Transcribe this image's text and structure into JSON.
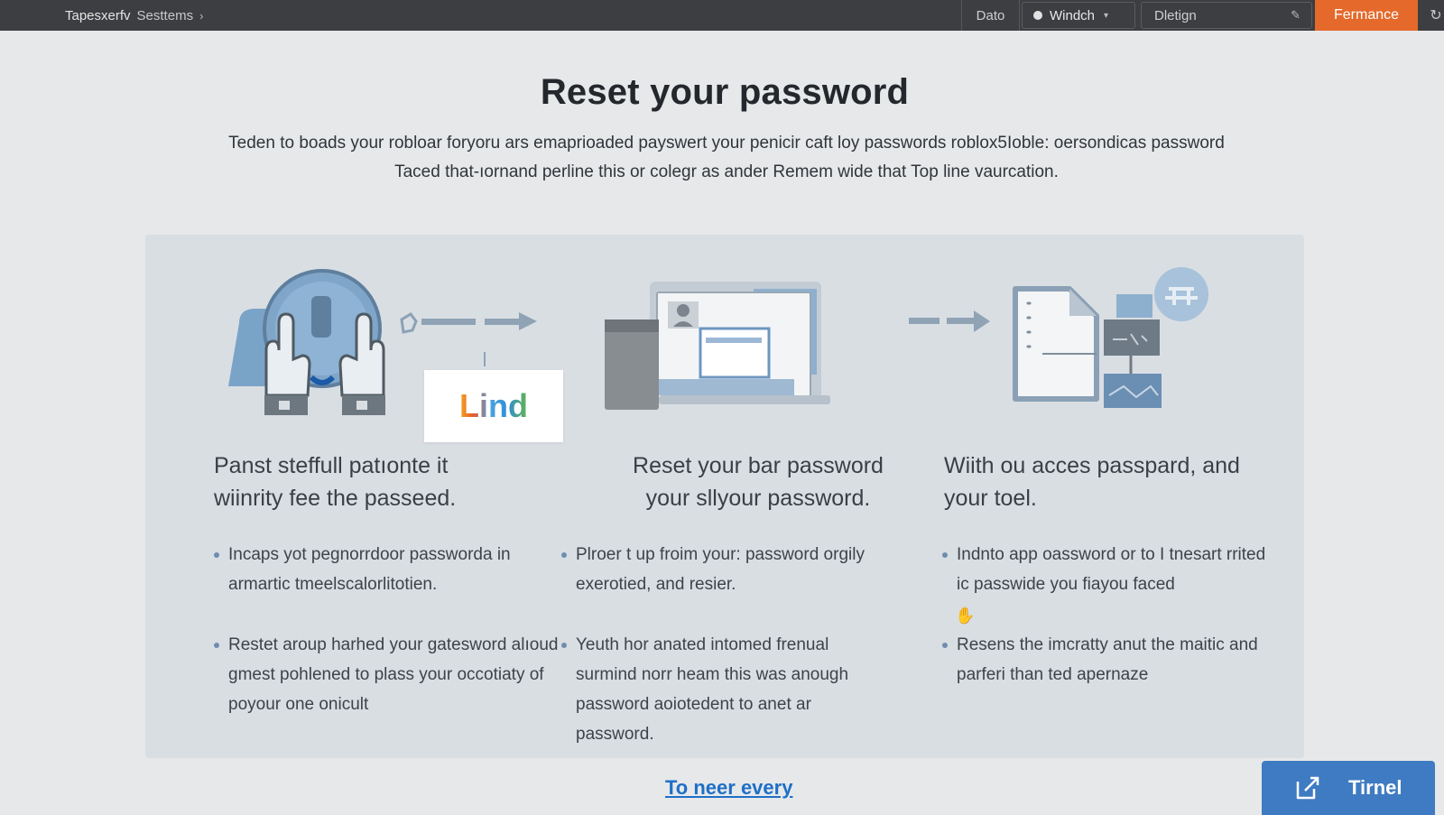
{
  "topbar": {
    "breadcrumb_root": "Tapesxerfv",
    "breadcrumb_current": "Sesttems",
    "breadcrumb_sep_icon": "chevron-right-icon",
    "date_label": "Dato",
    "window_label": "Windch",
    "design_label": "Dletign",
    "cta_label": "Fermance",
    "refresh_icon": "refresh-icon"
  },
  "colors": {
    "accent": "#e4692b",
    "link": "#1e6fc7",
    "button": "#3f7bc2",
    "topbar": "#3c3e41",
    "panel": "#d9dee3"
  },
  "page": {
    "title": "Reset your password",
    "intro_line1": "Teden to boads your robloar foryoru ars emaprioaded payswert your penicir caft loy passwords roblox5Ioble: oersondicas password",
    "intro_line2": "Taced that-ıornand perline this or colegr as ander Remem wide that Top line vaurcation."
  },
  "chip_text": "Lind",
  "steps": [
    {
      "heading_l1": "Panst steffull patıonte it",
      "heading_l2": "wiinrity fee the passeed.",
      "bullets": [
        "Incaps yot pegnorrdoor passworda in armartic tmeelscalorlitotien.",
        "Restet aroup harhed your gatesword alıoud gmest pohlened to plass your occotiaty of poyour one onicult"
      ]
    },
    {
      "heading_l1": "Reset your bar password",
      "heading_l2": "your sllyour password.",
      "bullets": [
        "Plroer t up froim your: password orgily exerotied, and resier.",
        "Yeuth hor anated intomed frenual surmind norr heam this was anough password aoiotedent to anet ar password."
      ]
    },
    {
      "heading_l1": "Wiith ou acces passpard, and",
      "heading_l2": "your toel.",
      "bullets": [
        "Indnto app oassword or to I tnesart rrited ic passwide you fiayou faced",
        "Resens the imcratty anut the maitic and parferi than ted apernaze"
      ]
    }
  ],
  "footer": {
    "link_label": "To neer every",
    "button_label": "Tirnel",
    "button_icon": "edit-square-icon"
  }
}
